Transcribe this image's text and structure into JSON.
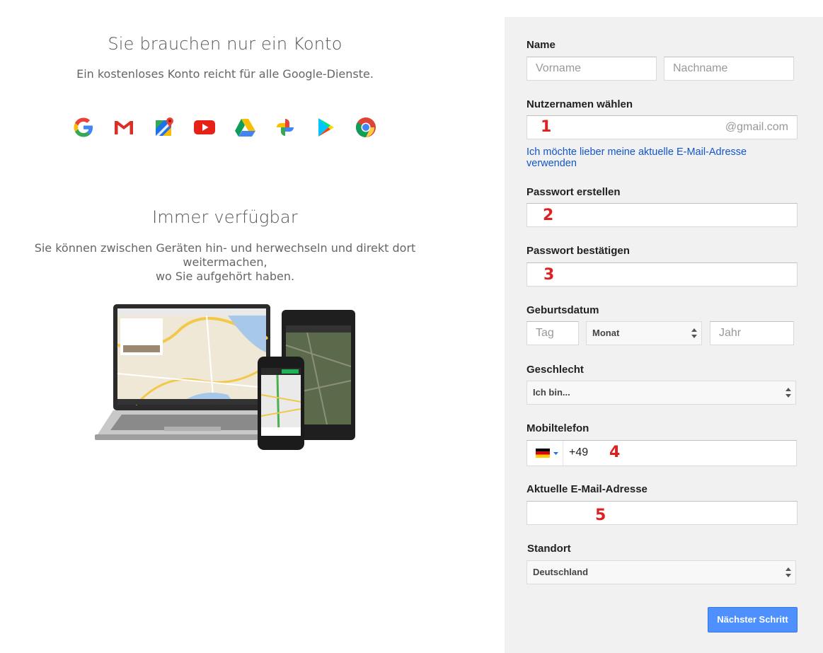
{
  "left": {
    "title1": "Sie brauchen nur ein Konto",
    "subtitle1": "Ein kostenloses Konto reicht für alle Google-Dienste.",
    "title2": "Immer verfügbar",
    "subtitle2_line1": "Sie können zwischen Geräten hin- und herwechseln und direkt dort weitermachen,",
    "subtitle2_line2": "wo Sie aufgehört haben.",
    "service_icons": [
      "google-icon",
      "gmail-icon",
      "maps-icon",
      "youtube-icon",
      "drive-icon",
      "photos-icon",
      "play-icon",
      "chrome-icon"
    ]
  },
  "form": {
    "name_label": "Name",
    "firstname_placeholder": "Vorname",
    "lastname_placeholder": "Nachname",
    "username_label": "Nutzernamen wählen",
    "username_suffix": "@gmail.com",
    "use_existing_email_link": "Ich möchte lieber meine aktuelle E-Mail-Adresse verwenden",
    "password_label": "Passwort erstellen",
    "confirm_password_label": "Passwort bestätigen",
    "birthday_label": "Geburtsdatum",
    "day_placeholder": "Tag",
    "month_value": "Monat",
    "year_placeholder": "Jahr",
    "gender_label": "Geschlecht",
    "gender_value": "Ich bin...",
    "mobile_label": "Mobiltelefon",
    "mobile_prefix": "+49",
    "current_email_label": "Aktuelle E-Mail-Adresse",
    "location_label": "Standort",
    "location_value": "Deutschland",
    "next_button": "Nächster Schritt"
  },
  "annotations": {
    "n1": "1",
    "n2": "2",
    "n3": "3",
    "n4": "4",
    "n5": "5"
  },
  "colors": {
    "panel_bg": "#f1f1f1",
    "link": "#1155cc",
    "button_bg": "#4d90fe",
    "annotation_red": "#e02020"
  }
}
